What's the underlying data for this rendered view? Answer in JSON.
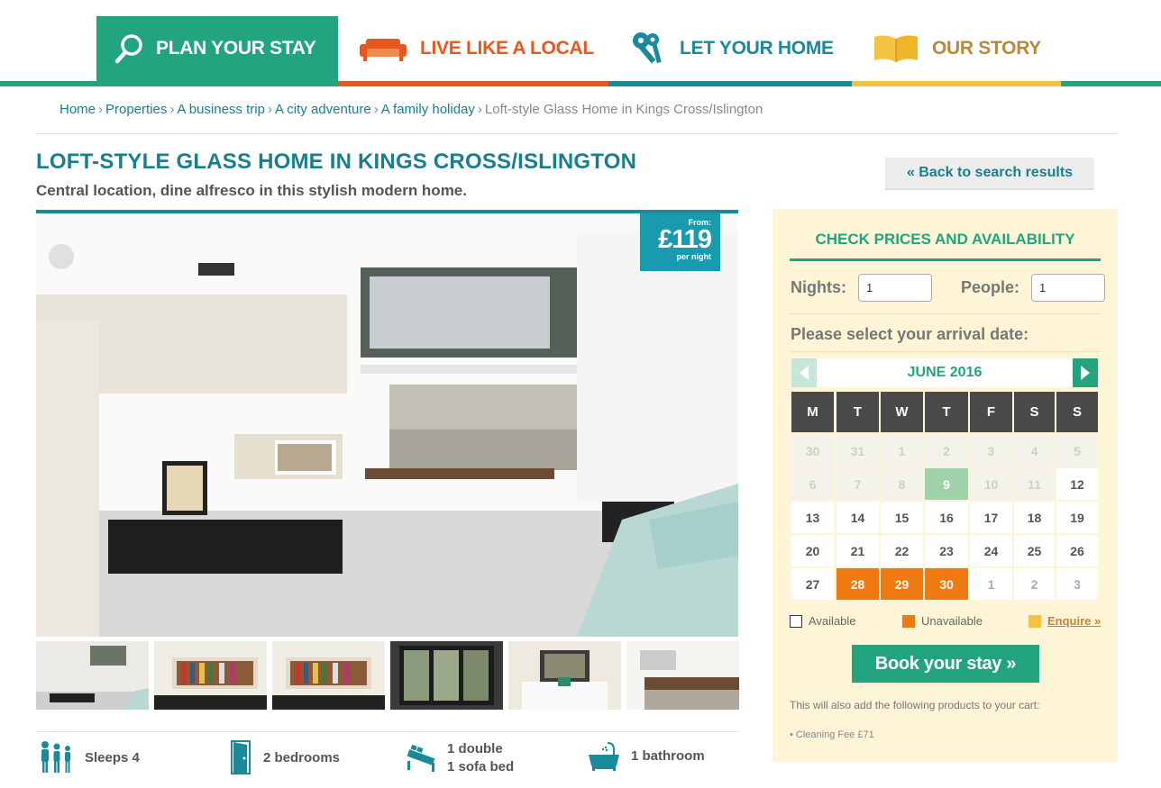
{
  "nav": {
    "items": [
      {
        "label": "PLAN YOUR STAY",
        "icon": "search-icon",
        "color": "#ffffff",
        "bar": "#22a57f"
      },
      {
        "label": "LIVE LIKE A LOCAL",
        "icon": "sofa-icon",
        "color": "#e8571d",
        "bar": "#e8571d"
      },
      {
        "label": "LET YOUR HOME",
        "icon": "keys-icon",
        "color": "#1a8a9a",
        "bar": "#1a8a9a"
      },
      {
        "label": "OUR STORY",
        "icon": "book-icon",
        "color": "#b8893a",
        "bar": "#f5c242"
      }
    ]
  },
  "breadcrumb": {
    "items": [
      "Home",
      "Properties",
      "A business trip",
      "A city adventure",
      "A family holiday"
    ],
    "current": "Loft-style Glass Home in Kings Cross/Islington",
    "separator": "›"
  },
  "property": {
    "title": "LOFT-STYLE GLASS HOME IN KINGS CROSS/ISLINGTON",
    "subtitle": "Central location, dine alfresco in this stylish modern home.",
    "back_label": "« Back to search results",
    "price_from": "From:",
    "price": "£119",
    "price_unit": "per night"
  },
  "features": {
    "sleeps": "Sleeps 4",
    "bedrooms": "2 bedrooms",
    "beds_1": "1 double",
    "beds_2": "1 sofa bed",
    "bathrooms": "1 bathroom"
  },
  "booking": {
    "title": "CHECK PRICES AND AVAILABILITY",
    "nights_label": "Nights:",
    "nights_value": "1",
    "people_label": "People:",
    "people_value": "1",
    "arrival_prompt": "Please select your arrival date:",
    "month": "JUNE 2016",
    "weekdays": [
      "M",
      "T",
      "W",
      "T",
      "F",
      "S",
      "S"
    ],
    "weeks": [
      [
        [
          "30",
          "past"
        ],
        [
          "31",
          "past"
        ],
        [
          "1",
          "past"
        ],
        [
          "2",
          "past"
        ],
        [
          "3",
          "past"
        ],
        [
          "4",
          "past"
        ],
        [
          "5",
          "past"
        ]
      ],
      [
        [
          "6",
          "past"
        ],
        [
          "7",
          "past"
        ],
        [
          "8",
          "past"
        ],
        [
          "9",
          "today"
        ],
        [
          "10",
          "past"
        ],
        [
          "11",
          "past"
        ],
        [
          "12",
          "avail"
        ]
      ],
      [
        [
          "13",
          "avail"
        ],
        [
          "14",
          "avail"
        ],
        [
          "15",
          "avail"
        ],
        [
          "16",
          "avail"
        ],
        [
          "17",
          "avail"
        ],
        [
          "18",
          "avail"
        ],
        [
          "19",
          "avail"
        ]
      ],
      [
        [
          "20",
          "avail"
        ],
        [
          "21",
          "avail"
        ],
        [
          "22",
          "avail"
        ],
        [
          "23",
          "avail"
        ],
        [
          "24",
          "avail"
        ],
        [
          "25",
          "avail"
        ],
        [
          "26",
          "avail"
        ]
      ],
      [
        [
          "27",
          "avail"
        ],
        [
          "28",
          "unav"
        ],
        [
          "29",
          "unav"
        ],
        [
          "30",
          "unav"
        ],
        [
          "1",
          "next"
        ],
        [
          "2",
          "next"
        ],
        [
          "3",
          "next"
        ]
      ]
    ],
    "legend_available": "Available",
    "legend_unavailable": "Unavailable",
    "legend_enquire": "Enquire »",
    "book_label": "Book your stay »",
    "note": "This will also add the following products to your cart:",
    "fee": "Cleaning Fee £71"
  }
}
